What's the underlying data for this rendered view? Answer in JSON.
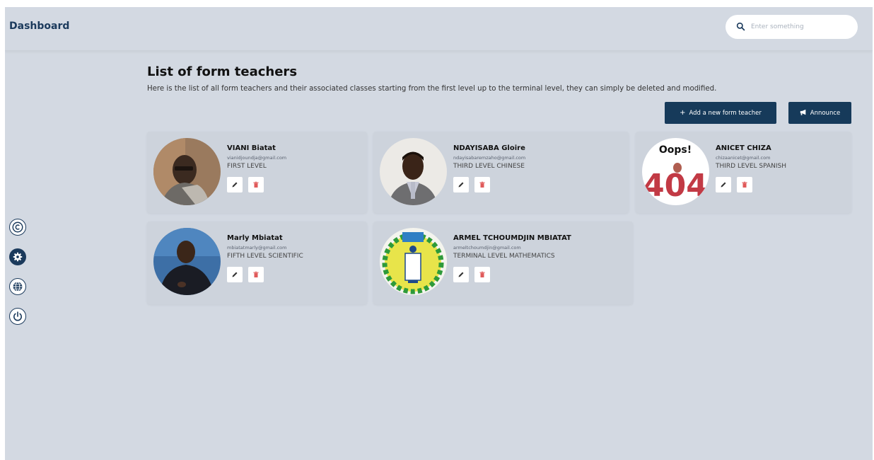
{
  "app": {
    "title": "Dashboard"
  },
  "search": {
    "placeholder": "Enter something"
  },
  "rail": {
    "items": [
      {
        "icon": "copyright-icon"
      },
      {
        "icon": "settings-icon"
      },
      {
        "icon": "globe-icon"
      },
      {
        "icon": "power-icon"
      }
    ]
  },
  "page": {
    "title": "List of form teachers",
    "subtitle": "Here is the list of all form teachers and their associated classes starting from the first level up to the terminal level, they can simply be deleted and modified.",
    "add_button": "Add a new form teacher",
    "announce_button": "Announce"
  },
  "teachers": [
    {
      "name": "VIANI Biatat",
      "email": "vianidjoundja@gmail.com",
      "level": "FIRST LEVEL"
    },
    {
      "name": "NDAYISABA Gloire",
      "email": "ndayisabaremzaho@gmail.com",
      "level": "THIRD LEVEL CHINESE"
    },
    {
      "name": "ANICET CHIZA",
      "email": "chizaanicet@gmail.com",
      "level": "THIRD LEVEL SPANISH",
      "avatar_text": "Oops!",
      "avatar_number": "404"
    },
    {
      "name": "Marly Mbiatat",
      "email": "mbiatatmarly@gmail.com",
      "level": "FIFTH LEVEL SCIENTIFIC"
    },
    {
      "name": "ARMEL TCHOUMDJIN MBIATAT",
      "email": "armeltchoumdjin@gmail.com",
      "level": "TERMINAL LEVEL MATHEMATICS"
    }
  ],
  "colors": {
    "primary": "#163a5a",
    "background": "#d3d9e2",
    "delete": "#e05a5a"
  }
}
